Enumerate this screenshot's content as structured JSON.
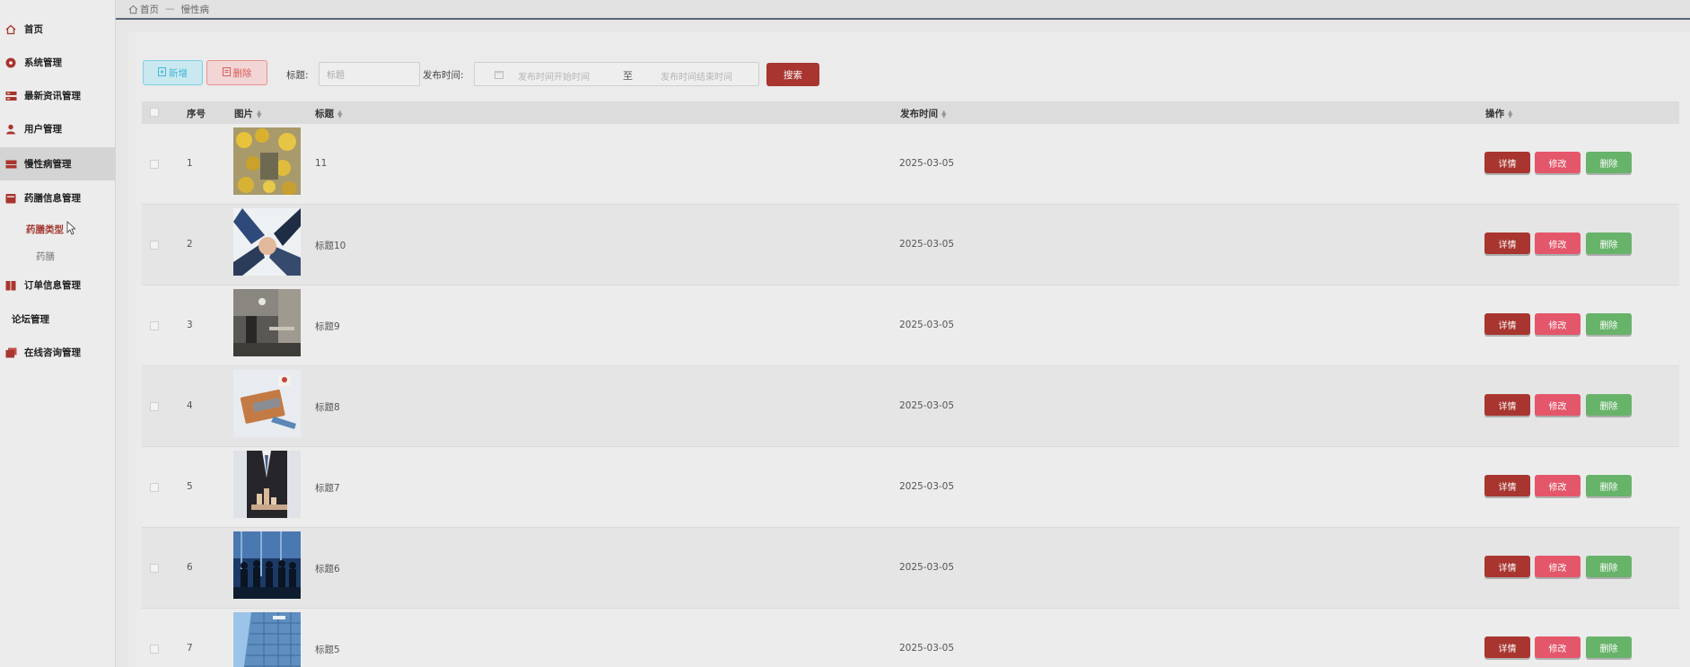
{
  "breadcrumb": {
    "home": "首页",
    "separator": "—",
    "current": "慢性病"
  },
  "sidebar": {
    "items": [
      {
        "label": "首页",
        "icon": "home-icon"
      },
      {
        "label": "系统管理",
        "icon": "settings-circle-icon"
      },
      {
        "label": "最新资讯管理",
        "icon": "news-icon"
      },
      {
        "label": "用户管理",
        "icon": "user-icon"
      },
      {
        "label": "慢性病管理",
        "icon": "chronic-disease-icon"
      },
      {
        "label": "药膳信息管理",
        "icon": "medicine-box-icon"
      },
      {
        "label": "订单信息管理",
        "icon": "order-icon"
      },
      {
        "label": "论坛管理",
        "icon": ""
      },
      {
        "label": "在线咨询管理",
        "icon": "consult-icon"
      }
    ],
    "subitems": [
      {
        "label": "药膳类型"
      },
      {
        "label": "药膳"
      }
    ]
  },
  "toolbar": {
    "add_label": "新增",
    "delete_label": "删除",
    "title_label": "标题:",
    "title_placeholder": "标题",
    "date_label": "发布时间:",
    "date_start_placeholder": "发布时间开始时间",
    "date_to": "至",
    "date_end_placeholder": "发布时间结束时间",
    "search_label": "搜索"
  },
  "table": {
    "headers": {
      "index": "序号",
      "image": "图片",
      "title": "标题",
      "date": "发布时间",
      "actions": "操作"
    },
    "actions": {
      "detail": "详情",
      "edit": "修改",
      "delete": "删除"
    },
    "rows": [
      {
        "index": "1",
        "title": "11",
        "date": "2025-03-05"
      },
      {
        "index": "2",
        "title": "标题10",
        "date": "2025-03-05"
      },
      {
        "index": "3",
        "title": "标题9",
        "date": "2025-03-05"
      },
      {
        "index": "4",
        "title": "标题8",
        "date": "2025-03-05"
      },
      {
        "index": "5",
        "title": "标题7",
        "date": "2025-03-05"
      },
      {
        "index": "6",
        "title": "标题6",
        "date": "2025-03-05"
      },
      {
        "index": "7",
        "title": "标题5",
        "date": "2025-03-05"
      }
    ]
  },
  "colors": {
    "accent": "#a8352f",
    "edit": "#e4566a",
    "delete": "#67b36a",
    "add": "#41b7d4"
  }
}
